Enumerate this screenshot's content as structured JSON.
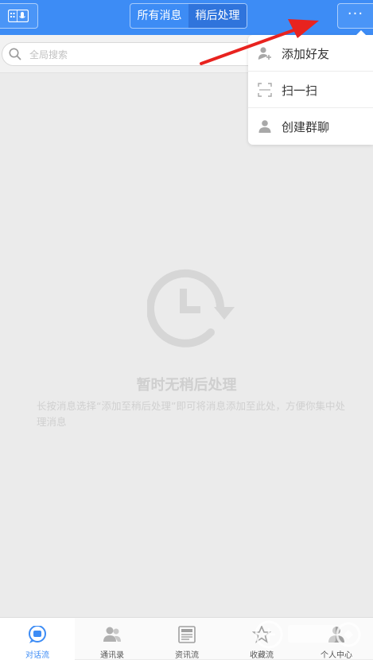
{
  "header": {
    "tabs": [
      {
        "label": "所有消息",
        "active": false
      },
      {
        "label": "稍后处理",
        "active": true
      }
    ],
    "more_label": "···"
  },
  "search": {
    "placeholder": "全局搜索",
    "value": ""
  },
  "menu": {
    "items": [
      {
        "label": "添加好友",
        "icon": "add-friend-icon"
      },
      {
        "label": "扫一扫",
        "icon": "scan-icon"
      },
      {
        "label": "创建群聊",
        "icon": "create-group-icon"
      }
    ]
  },
  "empty_state": {
    "icon": "clock-icon",
    "title": "暂时无稍后处理",
    "description": "长按消息选择“添加至稍后处理”即可将消息添加至此处，方便你集中处理消息"
  },
  "bottom_nav": {
    "items": [
      {
        "label": "对话流",
        "icon": "chat-icon",
        "active": true
      },
      {
        "label": "通讯录",
        "icon": "contacts-icon",
        "active": false
      },
      {
        "label": "资讯流",
        "icon": "news-icon",
        "active": false
      },
      {
        "label": "收藏流",
        "icon": "favorites-icon",
        "active": false
      },
      {
        "label": "个人中心",
        "icon": "profile-icon",
        "active": false
      }
    ]
  },
  "colors": {
    "accent": "#3d8cf5",
    "annotation_arrow": "#e8231f"
  }
}
